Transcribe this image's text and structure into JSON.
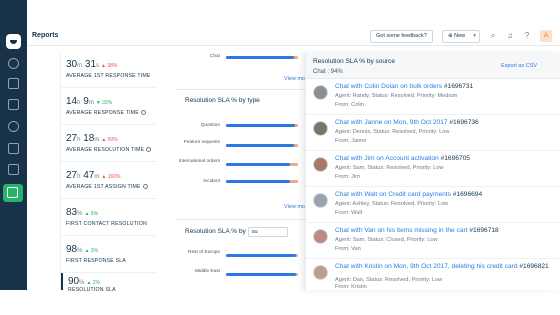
{
  "topbar": {
    "title": "Reports",
    "feedback_label": "Got some feedback?",
    "new_label": "New"
  },
  "metrics": [
    {
      "value": "30",
      "unit1": "m",
      "value2": "31",
      "unit2": "s",
      "trend": "▲ 38%",
      "trend_dir": "up",
      "label": "AVERAGE 1ST RESPONSE TIME"
    },
    {
      "value": "14",
      "unit1": "h",
      "value2": "9",
      "unit2": "m",
      "trend": "▼ 33%",
      "trend_dir": "good",
      "label": "AVERAGE RESPONSE TIME"
    },
    {
      "value": "27",
      "unit1": "h",
      "value2": "18",
      "unit2": "m",
      "trend": "▲ 50%",
      "trend_dir": "up",
      "label": "AVERAGE RESOLUTION TIME"
    },
    {
      "value": "27",
      "unit1": "h",
      "value2": "47",
      "unit2": "m",
      "trend": "▲ 160%",
      "trend_dir": "up",
      "label": "AVERAGE 1ST ASSIGN TIME"
    },
    {
      "value": "83",
      "unit1": "%",
      "value2": "",
      "unit2": "",
      "trend": "▲ 5%",
      "trend_dir": "good",
      "label": "FIRST CONTACT RESOLUTION"
    },
    {
      "value": "98",
      "unit1": "%",
      "value2": "",
      "unit2": "",
      "trend": "▲ 3%",
      "trend_dir": "good",
      "label": "FIRST RESPONSE SLA"
    },
    {
      "value": "90",
      "unit1": "%",
      "value2": "",
      "unit2": "",
      "trend": "▲ 2%",
      "trend_dir": "good",
      "label": "RESOLUTION SLA"
    }
  ],
  "center": {
    "top_bar_label": "Chat",
    "top_bar_value": 0.95,
    "view_more": "View more",
    "section1_title": "Resolution SLA % by type",
    "section1_bars": [
      {
        "label": "Question",
        "value": 0.96
      },
      {
        "label": "Feature requests",
        "value": 0.95
      },
      {
        "label": "International orders",
        "value": 0.89
      },
      {
        "label": "Incident",
        "value": 0.89
      }
    ],
    "section2_title": "Resolution SLA % by",
    "section2_select": "su",
    "section2_bars": [
      {
        "label": "Rest of Europe",
        "value": 0.97
      },
      {
        "label": "Middle East",
        "value": 0.97
      }
    ]
  },
  "panel": {
    "title": "Resolution SLA % by source",
    "subtitle": "Chat : 94%",
    "export_label": "Export as CSV",
    "tickets": [
      {
        "title": "Chat with Colin Dolan on bulk orders",
        "number": "#1696731",
        "meta": "Agent: Randy, Status: Resolved, Priority: Medium",
        "from": "From: Colin"
      },
      {
        "title": "Chat with Janne on Mon, 9th Oct 2017",
        "number": "#1696736",
        "meta": "Agent: Dennis, Status: Resolved, Priority: Low",
        "from": "From: Janne"
      },
      {
        "title": "Chat with Jim on Account activation",
        "number": "#1696705",
        "meta": "Agent: Sam, Status: Resolved, Priority: Low",
        "from": "From: Jim"
      },
      {
        "title": "Chat with Walt on Credit card payments",
        "number": "#1696694",
        "meta": "Agent: Ashley, Status: Resolved, Priority: Low",
        "from": "From: Walt"
      },
      {
        "title": "Chat with Van on his items missing in the cart",
        "number": "#1696718",
        "meta": "Agent: Sam, Status: Closed, Priority: Low",
        "from": "From: Van"
      },
      {
        "title": "Chat with Kristin on Mon, 9th Oct 2017, deleting his credit card",
        "number": "#1696821",
        "meta": "Agent: Dan, Status: Resolved, Priority: Low",
        "from": "From: Kristin"
      }
    ]
  },
  "colors": {
    "sidebar": "#183247",
    "accent": "#26b36e",
    "bar_fill": "#2c7be5",
    "bar_track": "#f0a68a",
    "link": "#2c7be5"
  },
  "icons": [
    "logo-icon",
    "dashboard-icon",
    "tickets-icon",
    "contacts-icon",
    "bell-icon",
    "book-icon",
    "settings-icon",
    "reports-icon",
    "search-icon",
    "notification-icon",
    "help-icon"
  ]
}
